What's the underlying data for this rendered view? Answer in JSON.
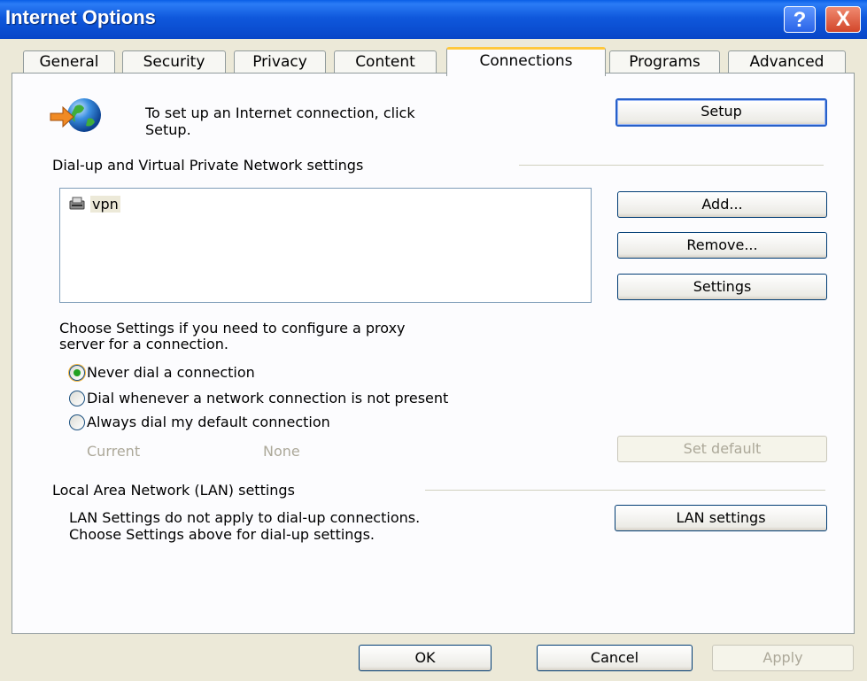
{
  "window": {
    "title": "Internet Options",
    "help": "?",
    "close": "X"
  },
  "tabs": [
    {
      "label": "General"
    },
    {
      "label": "Security"
    },
    {
      "label": "Privacy"
    },
    {
      "label": "Content"
    },
    {
      "label": "Connections"
    },
    {
      "label": "Programs"
    },
    {
      "label": "Advanced"
    }
  ],
  "setup": {
    "text_line1": "To set up an Internet connection, click",
    "text_line2": "Setup.",
    "button": "Setup"
  },
  "dialup": {
    "group_label": "Dial-up and Virtual Private Network settings",
    "entries": [
      {
        "name": "vpn"
      }
    ],
    "add_button": "Add...",
    "remove_button": "Remove...",
    "settings_button": "Settings",
    "proxy_hint_line1": "Choose Settings if you need to configure a proxy",
    "proxy_hint_line2": "server for a connection.",
    "options": [
      {
        "label": "Never dial a connection",
        "checked": true
      },
      {
        "label": "Dial whenever a network connection is not present",
        "checked": false
      },
      {
        "label": "Always dial my default connection",
        "checked": false
      }
    ],
    "current_label": "Current",
    "current_value": "None",
    "set_default_button": "Set default"
  },
  "lan": {
    "group_label": "Local Area Network (LAN) settings",
    "text_line1": "LAN Settings do not apply to dial-up connections.",
    "text_line2": "Choose Settings above for dial-up settings.",
    "button": "LAN settings"
  },
  "footer": {
    "ok": "OK",
    "cancel": "Cancel",
    "apply": "Apply"
  },
  "icons": {
    "connection_wizard": "globe-arrow-icon",
    "vpn_entry": "network-connection-icon"
  }
}
